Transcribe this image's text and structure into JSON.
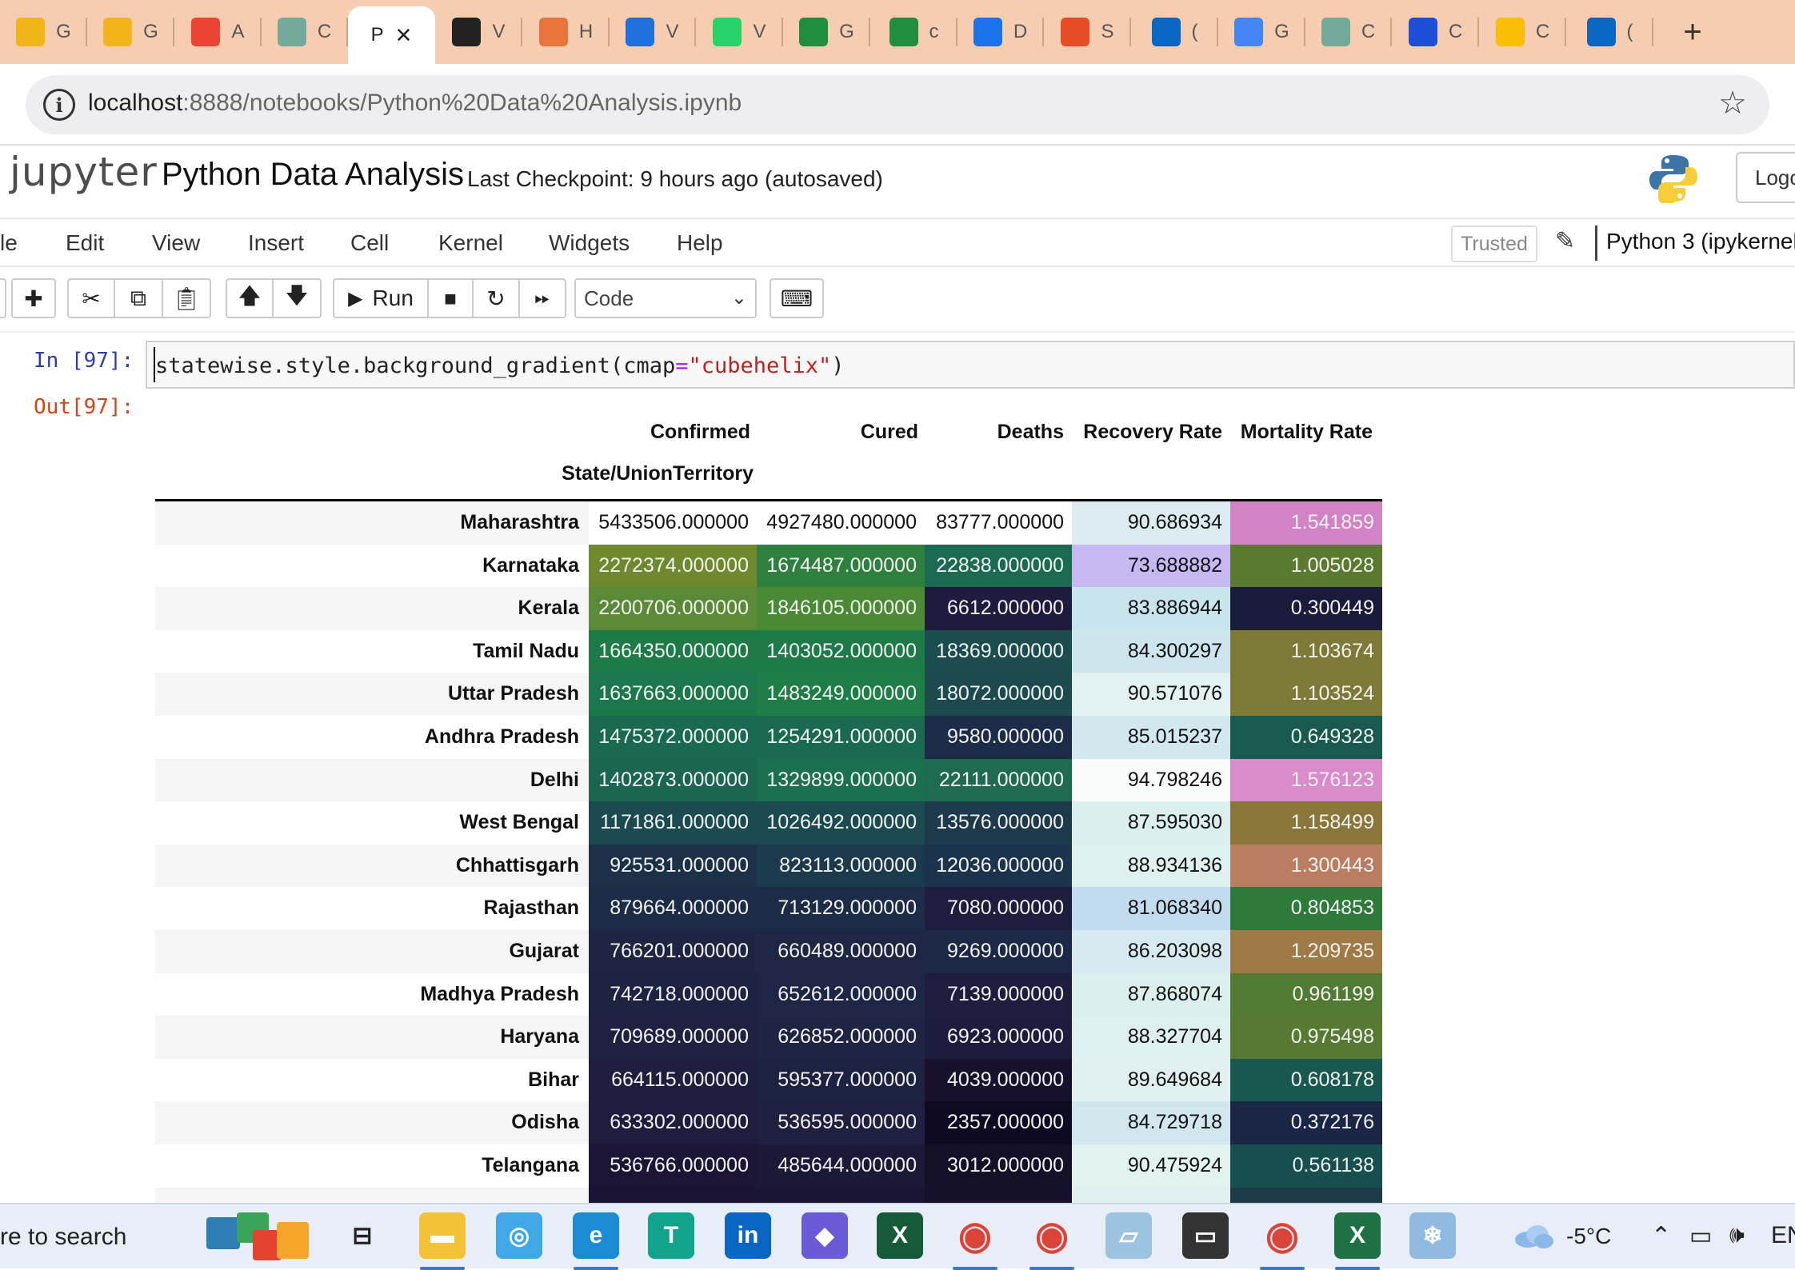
{
  "browser": {
    "tabs": [
      {
        "icon": "google-classroom-icon",
        "letter": "G",
        "color": "#f1b51b"
      },
      {
        "icon": "google-classroom-icon",
        "letter": "G",
        "color": "#f1b51b"
      },
      {
        "icon": "gmail-icon",
        "letter": "A",
        "color": "#ea4335"
      },
      {
        "icon": "chatgpt-icon",
        "letter": "C",
        "color": "#74aa9c"
      },
      {
        "icon": "",
        "letter": "P",
        "active": true
      },
      {
        "icon": "github-icon",
        "letter": "V",
        "color": "#222222"
      },
      {
        "icon": "loading-icon",
        "letter": "H",
        "color": "#e8743b"
      },
      {
        "icon": "x-tools-icon",
        "letter": "V",
        "color": "#1f6fd9"
      },
      {
        "icon": "whatsapp-icon",
        "letter": "V",
        "color": "#25d366"
      },
      {
        "icon": "google-sheets-icon",
        "letter": "G",
        "color": "#1e8e3e"
      },
      {
        "icon": "google-sheets-icon",
        "letter": "c",
        "color": "#1e8e3e"
      },
      {
        "icon": "info-icon",
        "letter": "D",
        "color": "#1a73e8"
      },
      {
        "icon": "notion-icon",
        "letter": "S",
        "color": "#e44d26"
      },
      {
        "icon": "linkedin-icon",
        "letter": "(",
        "color": "#0a66c2"
      },
      {
        "icon": "google-icon",
        "letter": "G",
        "color": "#4285f4"
      },
      {
        "icon": "chatgpt-icon",
        "letter": "C",
        "color": "#74aa9c"
      },
      {
        "icon": "k-icon",
        "letter": "C",
        "color": "#1d4ed8"
      },
      {
        "icon": "google-drive-icon",
        "letter": "C",
        "color": "#fbbc04"
      },
      {
        "icon": "linkedin-icon",
        "letter": "(",
        "color": "#0a66c2"
      }
    ],
    "url_host": "localhost",
    "url_path": ":8888/notebooks/Python%20Data%20Analysis.ipynb"
  },
  "jupyter": {
    "logo_text": "jupyter",
    "notebook_title": "Python Data Analysis",
    "checkpoint": "Last Checkpoint: 9 hours ago",
    "autosaved": "(autosaved)",
    "logout": "Logo",
    "menu": [
      "le",
      "Edit",
      "View",
      "Insert",
      "Cell",
      "Kernel",
      "Widgets",
      "Help"
    ],
    "trusted": "Trusted",
    "kernel": "Python 3 (ipykernel)",
    "run_label": "Run",
    "cell_type": "Code"
  },
  "cell": {
    "in_prompt": "In [97]:",
    "code_pre": "statewise.style.background_gradient(cmap",
    "code_eq": "=",
    "code_str": "\"cubehelix\"",
    "code_post": ")",
    "out_prompt": "Out[97]:"
  },
  "dataframe": {
    "columns": [
      "Confirmed",
      "Cured",
      "Deaths",
      "Recovery Rate",
      "Mortality Rate"
    ],
    "index_name": "State/UnionTerritory",
    "rows": [
      {
        "state": "Maharashtra",
        "values": [
          "5433506.000000",
          "4927480.000000",
          "83777.000000",
          "90.686934",
          "1.541859"
        ],
        "colors": [
          "#ffffff",
          "#ffffff",
          "#ffffff",
          "#dcebf0",
          "#d283c3"
        ]
      },
      {
        "state": "Karnataka",
        "values": [
          "2272374.000000",
          "1674487.000000",
          "22838.000000",
          "73.688882",
          "1.005028"
        ],
        "colors": [
          "#6f8a2e",
          "#2f7f3f",
          "#1b6b52",
          "#c8b8f2",
          "#5b7a30"
        ]
      },
      {
        "state": "Kerala",
        "values": [
          "2200706.000000",
          "1846105.000000",
          "6612.000000",
          "83.886944",
          "0.300449"
        ],
        "colors": [
          "#5a8a35",
          "#4a8a35",
          "#1e1b3e",
          "#c8e4ec",
          "#1a1a3a"
        ]
      },
      {
        "state": "Tamil Nadu",
        "values": [
          "1664350.000000",
          "1403052.000000",
          "18369.000000",
          "84.300297",
          "1.103674"
        ],
        "colors": [
          "#1f7a4a",
          "#1f7a4a",
          "#1c4d4e",
          "#cde6ee",
          "#7d7a37"
        ]
      },
      {
        "state": "Uttar Pradesh",
        "values": [
          "1637663.000000",
          "1483249.000000",
          "18072.000000",
          "90.571076",
          "1.103524"
        ],
        "colors": [
          "#1c774b",
          "#1f7d48",
          "#1c4a4d",
          "#e2f2f2",
          "#7d7a37"
        ]
      },
      {
        "state": "Andhra Pradesh",
        "values": [
          "1475372.000000",
          "1254291.000000",
          "9580.000000",
          "85.015237",
          "0.649328"
        ],
        "colors": [
          "#1a6a52",
          "#1a6a52",
          "#1c2b48",
          "#d2e8ef",
          "#195a4f"
        ]
      },
      {
        "state": "Delhi",
        "values": [
          "1402873.000000",
          "1329899.000000",
          "22111.000000",
          "94.798246",
          "1.576123"
        ],
        "colors": [
          "#1a6650",
          "#1b7050",
          "#1f6b52",
          "#fafbfb",
          "#d98bca"
        ]
      },
      {
        "state": "West Bengal",
        "values": [
          "1171861.000000",
          "1026492.000000",
          "13576.000000",
          "87.595030",
          "1.158499"
        ],
        "colors": [
          "#1a4b50",
          "#1a4b50",
          "#1c3a4c",
          "#dbeef0",
          "#8a7638"
        ]
      },
      {
        "state": "Chhattisgarh",
        "values": [
          "925531.000000",
          "823113.000000",
          "12036.000000",
          "88.934136",
          "1.300443"
        ],
        "colors": [
          "#1c3048",
          "#1b3a4c",
          "#1c344b",
          "#dff0f1",
          "#b97e5f"
        ]
      },
      {
        "state": "Rajasthan",
        "values": [
          "879664.000000",
          "713129.000000",
          "7080.000000",
          "81.068340",
          "0.804853"
        ],
        "colors": [
          "#1d2c46",
          "#1c2c47",
          "#1e1d3e",
          "#c2dbee",
          "#2e7a3a"
        ]
      },
      {
        "state": "Gujarat",
        "values": [
          "766201.000000",
          "660489.000000",
          "9269.000000",
          "86.203098",
          "1.209735"
        ],
        "colors": [
          "#1e2442",
          "#1d2744",
          "#1c2846",
          "#d6eaef",
          "#a07a45"
        ]
      },
      {
        "state": "Madhya Pradesh",
        "values": [
          "742718.000000",
          "652612.000000",
          "7139.000000",
          "87.868074",
          "0.961199"
        ],
        "colors": [
          "#1e2341",
          "#1d2644",
          "#1e1d3e",
          "#dcefef",
          "#527a32"
        ]
      },
      {
        "state": "Haryana",
        "values": [
          "709689.000000",
          "626852.000000",
          "6923.000000",
          "88.327704",
          "0.975498"
        ],
        "colors": [
          "#1f2140",
          "#1e2442",
          "#1e1c3d",
          "#ddeff0",
          "#567a31"
        ]
      },
      {
        "state": "Bihar",
        "values": [
          "664115.000000",
          "595377.000000",
          "4039.000000",
          "89.649684",
          "0.608178"
        ],
        "colors": [
          "#1f1e3e",
          "#1e2241",
          "#17112e",
          "#e0f0f1",
          "#18584e"
        ]
      },
      {
        "state": "Odisha",
        "values": [
          "633302.000000",
          "536595.000000",
          "2357.000000",
          "84.729718",
          "0.372176"
        ],
        "colors": [
          "#1f1d3d",
          "#1f1f3f",
          "#0e0a22",
          "#d0e7ee",
          "#1b2545"
        ]
      },
      {
        "state": "Telangana",
        "values": [
          "536766.000000",
          "485644.000000",
          "3012.000000",
          "90.475924",
          "0.561138"
        ],
        "colors": [
          "#1c1535",
          "#1c1838",
          "#131028",
          "#e2f2f1",
          "#174f4e"
        ]
      },
      {
        "state": "",
        "values": [
          "",
          "",
          "",
          "",
          ""
        ],
        "colors": [
          "#1a1332",
          "#1a1433",
          "#150f2b",
          "#e0f0f1",
          "#1e3a4a"
        ]
      }
    ]
  },
  "taskbar": {
    "search_text": "re to search",
    "apps": [
      {
        "icon": "task-view-icon",
        "color": "#e7eef7"
      },
      {
        "icon": "file-explorer-icon",
        "color": "#f3c237"
      },
      {
        "icon": "cortana-icon",
        "color": "#41a8e6"
      },
      {
        "icon": "edge-icon",
        "color": "#1b8bd6"
      },
      {
        "icon": "teams-t-icon",
        "color": "#12a38c"
      },
      {
        "icon": "linkedin-icon",
        "color": "#0a66c2"
      },
      {
        "icon": "copilot-icon",
        "color": "#6a5ad6"
      },
      {
        "icon": "excel-x-icon",
        "color": "#165a3a"
      },
      {
        "icon": "chrome-icon",
        "color": "#e7eef7"
      },
      {
        "icon": "chrome-profile-icon",
        "color": "#e7eef7"
      },
      {
        "icon": "notes-icon",
        "color": "#9cc3e0"
      },
      {
        "icon": "terminal-icon",
        "color": "#333333"
      },
      {
        "icon": "chrome-profile-2-icon",
        "color": "#e7eef7"
      },
      {
        "icon": "excel-icon",
        "color": "#1e7145"
      },
      {
        "icon": "snowflake-icon",
        "color": "#8fb9df"
      }
    ],
    "temperature": "-5°C",
    "lang": "EN"
  }
}
